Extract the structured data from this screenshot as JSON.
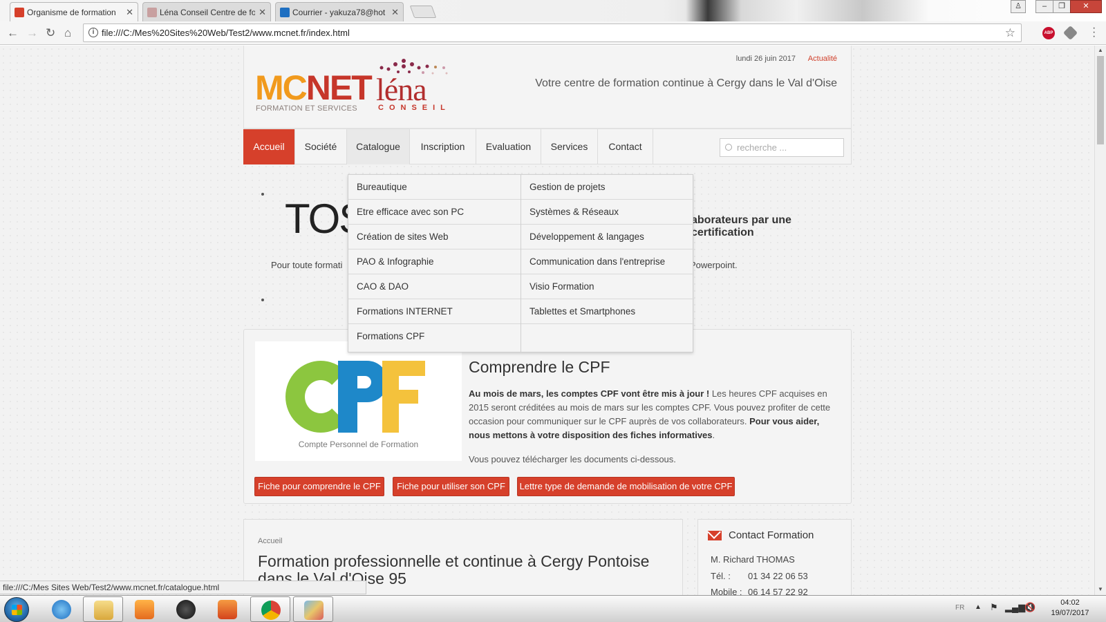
{
  "browser": {
    "tabs": [
      {
        "title": "Organisme de formation",
        "active": true
      },
      {
        "title": "Léna Conseil Centre de fo",
        "active": false
      },
      {
        "title": "Courrier - yakuza78@hot",
        "active": false
      }
    ],
    "url": "file:///C:/Mes%20Sites%20Web/Test2/www.mcnet.fr/index.html",
    "status_url": "file:///C:/Mes Sites Web/Test2/www.mcnet.fr/catalogue.html"
  },
  "header": {
    "logo_mc": "MC",
    "logo_net": "NET",
    "logo_sub": "FORMATION ET SERVICES",
    "lena": "léna",
    "lena_sub": "CONSEIL",
    "date": "lundi 26 juin 2017",
    "actualite": "Actualité",
    "tagline": "Votre centre de formation continue à Cergy dans le Val d'Oise"
  },
  "nav": {
    "items": [
      "Accueil",
      "Société",
      "Catalogue",
      "Inscription",
      "Evaluation",
      "Services",
      "Contact"
    ],
    "search_placeholder": "recherche ..."
  },
  "dropdown": {
    "left": [
      "Bureautique",
      "Etre efficace avec son PC",
      "Création de sites Web",
      "PAO & Infographie",
      "CAO & DAO",
      "Formations INTERNET",
      "Formations CPF"
    ],
    "right": [
      "Gestion de projets",
      "Systèmes & Réseaux",
      "Développement & langages",
      "Communication dans l'entreprise",
      "Visio Formation",
      "Tablettes et Smartphones"
    ]
  },
  "slider": {
    "big": "TOS",
    "right_heading": "aborateurs par une certification",
    "text_left": "Pour toute formati",
    "text_right": "Powerpoint."
  },
  "cpf": {
    "caption": "Compte Personnel de Formation",
    "title": "Comprendre le CPF",
    "p1_bold": "Au mois de mars, les comptes CPF vont être mis à jour !",
    "p1_text": " Les heures CPF acquises en 2015 seront créditées au mois de mars sur les comptes CPF. Vous pouvez profiter de cette occasion pour communiquer sur le CPF auprès de vos collaborateurs. ",
    "p1_bold2": "Pour vous aider, nous mettons à votre disposition des fiches informatives",
    "p1_end": ".",
    "p2": "Vous pouvez télécharger les documents ci-dessous.",
    "buttons": [
      "Fiche pour comprendre le CPF",
      "Fiche pour utiliser son CPF",
      "Lettre type de demande de mobilisation de votre CPF"
    ]
  },
  "main": {
    "breadcrumb": "Accueil",
    "title": "Formation professionnelle et continue à Cergy Pontoise dans le Val d'Oise 95"
  },
  "contact": {
    "title": "Contact Formation",
    "name": "M. Richard THOMAS",
    "tel_label": "Tél. :",
    "tel": "01 34 22 06 53",
    "mobile_label": "Mobile :",
    "mobile": "06 14 57 22 92"
  },
  "taskbar": {
    "lang": "FR",
    "time": "04:02",
    "date": "19/07/2017"
  },
  "colors": {
    "accent_red": "#d6402b",
    "mcnet_orange": "#f19a1d",
    "lena_red": "#b22e2e"
  }
}
